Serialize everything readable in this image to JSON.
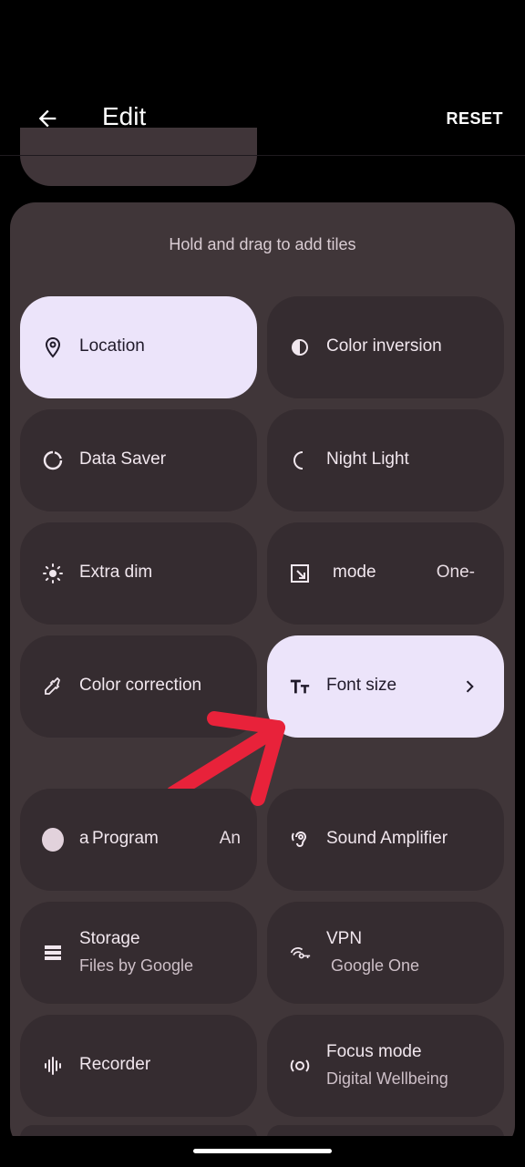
{
  "header": {
    "title": "Edit",
    "reset_label": "RESET"
  },
  "panel": {
    "hint": "Hold and drag to add tiles"
  },
  "tiles": [
    {
      "label": "Location",
      "icon": "location-pin-icon",
      "active": true
    },
    {
      "label": "Color inversion",
      "icon": "color-inversion-icon"
    },
    {
      "label": "Data Saver",
      "icon": "data-saver-icon"
    },
    {
      "label": "Night Light",
      "icon": "moon-icon"
    },
    {
      "label": "Extra dim",
      "icon": "brightness-icon"
    },
    {
      "label": "mode",
      "extra": "One-",
      "icon": "one-handed-mode-icon"
    },
    {
      "label": "Color correction",
      "icon": "eyedropper-icon"
    },
    {
      "label": "Font size",
      "icon": "font-size-icon",
      "active": true
    },
    {
      "label": "Program",
      "extra": "An",
      "icon": "app-circle-icon",
      "prefix": "a"
    },
    {
      "label": "Sound Amplifier",
      "icon": "ear-icon"
    },
    {
      "label": "Storage",
      "sub": "Files by Google",
      "icon": "storage-icon"
    },
    {
      "label": "VPN",
      "sub": "Google One",
      "icon": "vpn-key-icon"
    },
    {
      "label": "Recorder",
      "icon": "recorder-waveform-icon"
    },
    {
      "label": "Focus mode",
      "sub": "Digital Wellbeing",
      "icon": "focus-mode-icon"
    }
  ],
  "colors": {
    "panel": "#403639",
    "tile": "#352c30",
    "tile_active": "#ece4fa",
    "arrow": "#e8223a"
  }
}
